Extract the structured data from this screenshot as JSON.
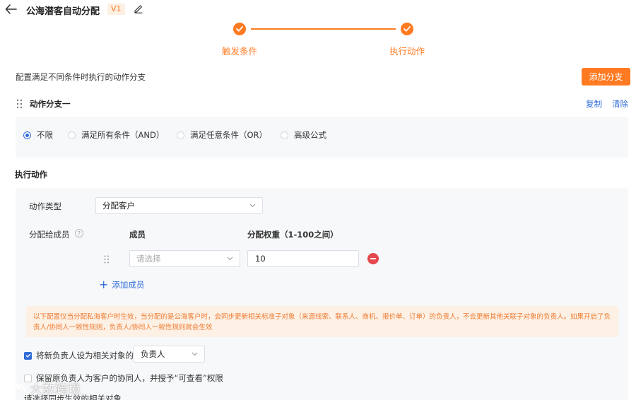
{
  "header": {
    "title": "公海潜客自动分配",
    "version": "V1"
  },
  "steps": [
    {
      "label": "触发条件",
      "done": true
    },
    {
      "label": "执行动作",
      "done": true
    }
  ],
  "description": "配置满足不同条件时执行的动作分支",
  "add_branch_label": "添加分支",
  "branch": {
    "title": "动作分支一",
    "copy_label": "复制",
    "clear_label": "清除",
    "conditions": [
      {
        "label": "不限",
        "selected": true
      },
      {
        "label": "满足所有条件（AND）",
        "selected": false
      },
      {
        "label": "满足任意条件（OR）",
        "selected": false
      },
      {
        "label": "高级公式",
        "selected": false
      }
    ]
  },
  "actions": {
    "section_title": "执行动作",
    "type_label": "动作类型",
    "type_value": "分配客户",
    "assign_label": "分配给成员",
    "member_col": "成员",
    "weight_col": "分配权重（1-100之间）",
    "member_placeholder": "请选择",
    "weight_value": "10",
    "add_member_label": "添加成员",
    "notice": "以下配置仅当分配私海客户时生效，当分配的是公海客户时，会同步更新相关标准子对象（来源线索、联系人、商机、报价单、订单）的负责人，不会更新其他关联子对象的负责人。如果开启了负责人/协同人一致性规则，负责人/协同人一致性规则就会生效",
    "set_owner_label": "将新负责人设为相关对象的",
    "set_owner_checked": true,
    "owner_select_value": "负责人",
    "keep_owner_label": "保留原负责人为客户的协同人，并授予“可查看”权限",
    "keep_owner_checked": false,
    "sync_label": "请选择同步生效的相关对象"
  },
  "watermark": "大数跨境",
  "colors": {
    "accent": "#ff7a21",
    "link": "#2e6bd8",
    "danger": "#e5484d",
    "panel": "#f7f8fa"
  }
}
